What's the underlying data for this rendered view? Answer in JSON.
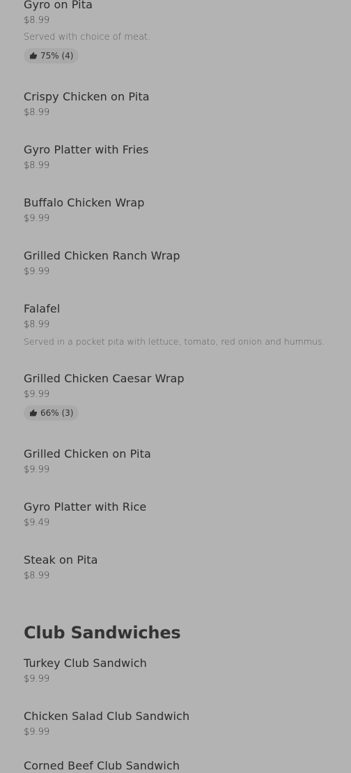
{
  "sections": {
    "top_items": [
      {
        "name": "Gyro on Pita",
        "price": "$8.99",
        "description": "Served with choice of meat.",
        "rating": "75% (4)"
      },
      {
        "name": "Crispy Chicken on Pita",
        "price": "$8.99"
      },
      {
        "name": "Gyro Platter with Fries",
        "price": "$8.99"
      },
      {
        "name": "Buffalo Chicken Wrap",
        "price": "$9.99"
      },
      {
        "name": "Grilled Chicken Ranch Wrap",
        "price": "$9.99"
      },
      {
        "name": "Falafel",
        "price": "$8.99",
        "description": "Served in a pocket pita with lettuce, tomato, red onion and hummus."
      },
      {
        "name": "Grilled Chicken Caesar Wrap",
        "price": "$9.99",
        "rating": "66% (3)"
      },
      {
        "name": "Grilled Chicken on Pita",
        "price": "$9.99"
      },
      {
        "name": "Gyro Platter with Rice",
        "price": "$9.49"
      },
      {
        "name": "Steak on Pita",
        "price": "$8.99"
      }
    ],
    "club": {
      "title": "Club Sandwiches",
      "items": [
        {
          "name": "Turkey Club Sandwich",
          "price": "$9.99"
        },
        {
          "name": "Chicken Salad Club Sandwich",
          "price": "$9.99"
        },
        {
          "name": "Corned Beef Club Sandwich",
          "price": ""
        }
      ]
    }
  },
  "icons": {
    "rating": "thumbs-up-icon"
  }
}
